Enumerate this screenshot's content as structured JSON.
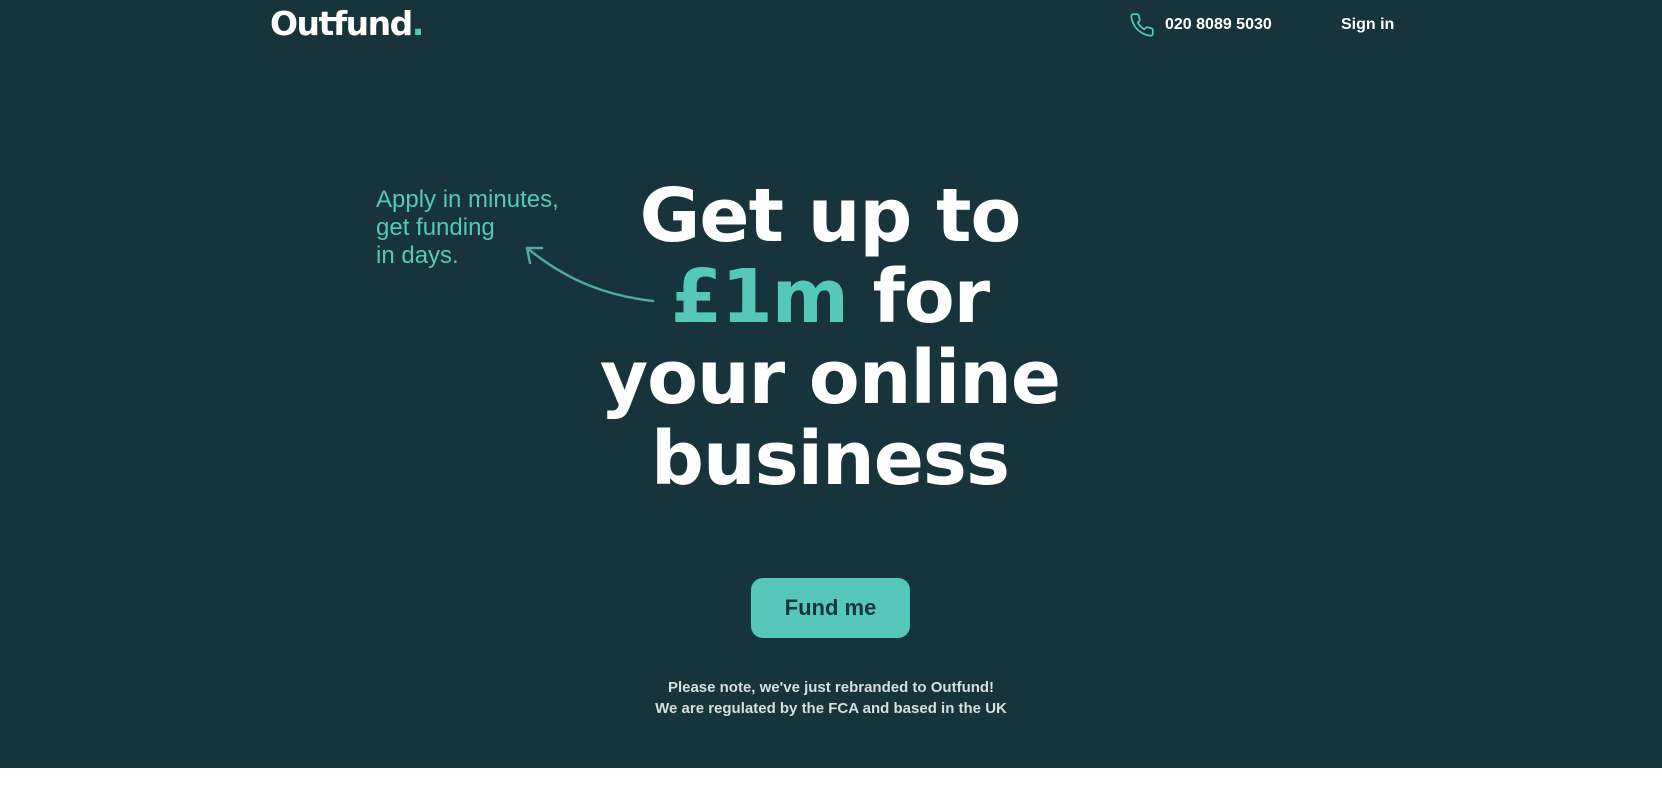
{
  "header": {
    "logo_text": "Outfund",
    "logo_dot": ".",
    "phone_icon": "phone-icon",
    "phone_number": "020 8089 5030",
    "signin_label": "Sign in"
  },
  "hero": {
    "tagline": [
      "Apply in minutes,",
      "get funding",
      "in days."
    ],
    "arrow_icon": "curved-arrow-icon",
    "headline_line1": "Get up to",
    "headline_amount": "£1m",
    "headline_line2_rest": " for",
    "headline_line3": "your online",
    "headline_line4": "business",
    "cta_label": "Fund me",
    "note_line1": "Please note, we've just rebranded to Outfund!",
    "note_line2": "We are regulated by the FCA and based in the UK"
  },
  "colors": {
    "background": "#17333b",
    "accent": "#56c8ba",
    "text": "#ffffff"
  }
}
